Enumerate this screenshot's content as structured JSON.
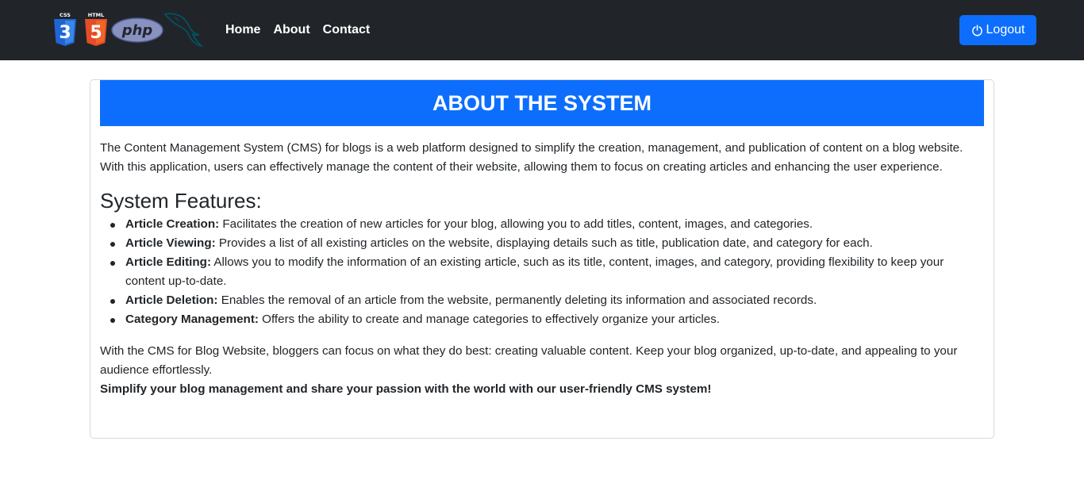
{
  "nav": {
    "logos": {
      "css_text": "CSS",
      "css_number": "3",
      "html_text": "HTML",
      "html_number": "5",
      "php_text": "php"
    },
    "links": [
      "Home",
      "About",
      "Contact"
    ],
    "logout_label": "Logout",
    "logout_icon": "power-icon"
  },
  "colors": {
    "navbar_bg": "#212529",
    "primary": "#0d6efd",
    "css_blue": "#1f65d6",
    "html_orange": "#e44d26",
    "php_purple": "#8892bf"
  },
  "card": {
    "title": "ABOUT THE SYSTEM",
    "intro": "The Content Management System (CMS) for blogs is a web platform designed to simplify the creation, management, and publication of content on a blog website. With this application, users can effectively manage the content of their website, allowing them to focus on creating articles and enhancing the user experience.",
    "features_title": "System Features:",
    "features": [
      {
        "name": "Article Creation:",
        "desc": " Facilitates the creation of new articles for your blog, allowing you to add titles, content, images, and categories."
      },
      {
        "name": "Article Viewing:",
        "desc": " Provides a list of all existing articles on the website, displaying details such as title, publication date, and category for each."
      },
      {
        "name": "Article Editing:",
        "desc": " Allows you to modify the information of an existing article, such as its title, content, images, and category, providing flexibility to keep your content up-to-date."
      },
      {
        "name": "Article Deletion:",
        "desc": " Enables the removal of an article from the website, permanently deleting its information and associated records."
      },
      {
        "name": "Category Management:",
        "desc": " Offers the ability to create and manage categories to effectively organize your articles."
      }
    ],
    "closing": "With the CMS for Blog Website, bloggers can focus on what they do best: creating valuable content. Keep your blog organized, up-to-date, and appealing to your audience effortlessly.",
    "slogan": "Simplify your blog management and share your passion with the world with our user-friendly CMS system!"
  }
}
